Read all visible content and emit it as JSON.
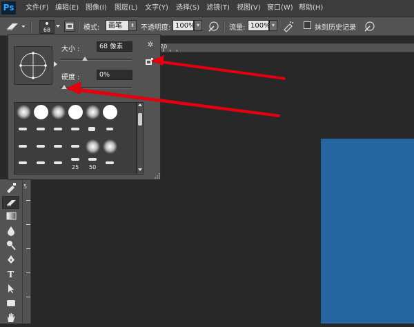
{
  "app": {
    "logo": "Ps"
  },
  "menu": [
    "文件(F)",
    "编辑(E)",
    "图像(I)",
    "图层(L)",
    "文字(Y)",
    "选择(S)",
    "滤镜(T)",
    "视图(V)",
    "窗口(W)",
    "帮助(H)"
  ],
  "options": {
    "brush_size": "68",
    "mode_label": "模式:",
    "mode_value": "画笔",
    "opacity_label": "不透明度:",
    "opacity_value": "100%",
    "flow_label": "流量:",
    "flow_value": "100%",
    "erase_history_label": "抹到历史记录"
  },
  "brush_panel": {
    "size_label": "大小 :",
    "size_value": "68 像素",
    "size_fraction": 0.35,
    "hardness_label": "硬度 :",
    "hardness_value": "0%",
    "hardness_fraction": 0.0,
    "preset_labels": {
      "p25": "25",
      "p50": "50"
    }
  },
  "ruler": {
    "top_label": "20",
    "left_label": "5"
  },
  "colors": {
    "canvas_fill": "#2566a1",
    "annotation_arrow": "#e3000f",
    "logo": "#31a8ff"
  },
  "icons": {
    "tool_options": [
      "eraser-icon",
      "brush-picker-icon",
      "brush-panel-toggle-icon",
      "airbrush-icon",
      "tablet-pressure-icon"
    ],
    "tools": [
      "healing-brush-icon",
      "eraser-icon",
      "gradient-icon",
      "blur-icon",
      "dodge-icon",
      "pen-icon",
      "type-icon",
      "path-select-icon",
      "shape-icon",
      "hand-icon"
    ]
  }
}
